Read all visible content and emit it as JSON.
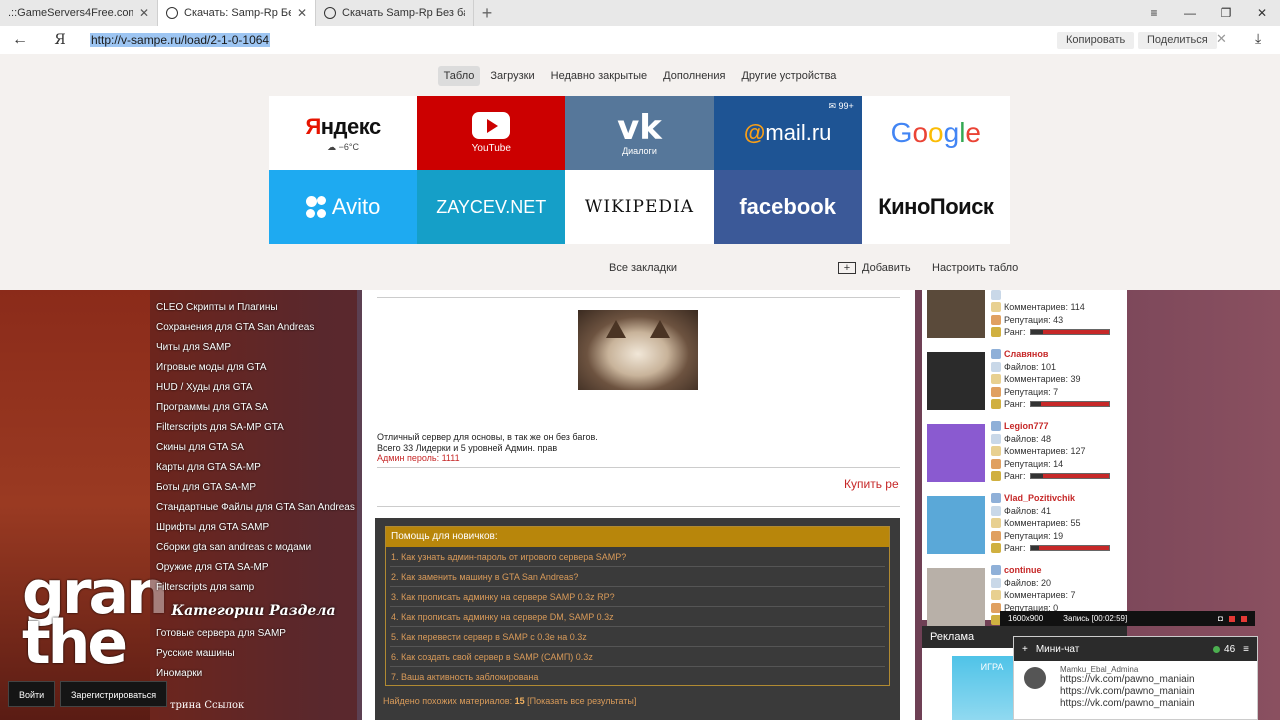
{
  "browser": {
    "tabs": [
      {
        "label": ".::GameServers4Free.com::.",
        "active": false
      },
      {
        "label": "Скачать: Samp-Rp Без б",
        "active": true
      },
      {
        "label": "Скачать Samp-Rp Без багов",
        "active": false
      }
    ],
    "url": "http://v-sampe.ru/load/2-1-0-1064",
    "ya": "Я",
    "copy": "Копировать",
    "share": "Поделиться"
  },
  "tablo": {
    "nav": [
      "Табло",
      "Загрузки",
      "Недавно закрытые",
      "Дополнения",
      "Другие устройства"
    ],
    "tiles": {
      "yandex_logo_a": "Я",
      "yandex_logo_b": "ндекс",
      "yandex_weather": "☁ −6°C",
      "youtube_caption": "YouTube",
      "vk_caption": "Диалоги",
      "mail_badge": "✉ 99+",
      "mail_logo_b": "mail.ru",
      "avito": "Avito",
      "zaycev": "ZAYCEV.NET",
      "wikipedia": "WIKIPEDIA",
      "facebook": "facebook",
      "kinopoisk": "КиноПоиск"
    },
    "all_bookmarks": "Все закладки",
    "add": "Добавить",
    "configure": "Настроить табло"
  },
  "sidebar": {
    "items_top": [
      "CLEO Скрипты и Плагины",
      "Сохранения для GTA San Andreas",
      "Читы для SAMP",
      "Игровые моды для GTA",
      "HUD / Худы для GTA",
      "Программы для GTA SA",
      "Filterscripts для SA-MP GTA",
      "Скины для GTA SA",
      "Карты для GTA SA-MP",
      "Боты для GTA SA-MP",
      "Стандартные Файлы для GTA San Andreas",
      "Шрифты для GTA SAMP",
      "Сборки gta san andreas с модами",
      "Оружие для GTA SA-MP",
      "Filterscripts для samp"
    ],
    "heading": "Категории Раздела",
    "items_bottom": [
      "Готовые сервера для SAMP",
      "Русские машины",
      "Иномарки"
    ],
    "vitrina": "трина Ссылок"
  },
  "content": {
    "desc_line1": "Отличный сервер для основы, в так же он без багов.",
    "desc_line2": "Всего 33 Лидерки и 5 уровней Админ. прав",
    "desc_line3": "Админ пероль: 1111",
    "buy": "Купить ре",
    "help_title": "Помощь для новичков:",
    "help_questions": [
      "1. Как узнать админ-пароль от игрового сервера SAMP?",
      "2. Как заменить машину в GTA San Andreas?",
      "3. Как прописать админку на сервере SAMP 0.3z RP?",
      "4. Как прописать админку на сервере DM, SAMP 0.3z",
      "5. Как перевести сервер в SAMP с 0.3e на 0.3z",
      "6. Как создать свой сервер в SAMP (САМП) 0.3z",
      "7. Ваша активность заблокирована"
    ],
    "found_prefix": "Найдено похожих материалов:",
    "found_count": "15",
    "found_link": "[Показать все результаты]"
  },
  "users": [
    {
      "name": "",
      "files": "",
      "comments": "Комментариев: 114",
      "rep": "Репутация: 43",
      "rank": "Ранг:",
      "level": 0.15,
      "avatar": "#5a4a3a"
    },
    {
      "name": "Славянов",
      "files": "Файлов: 101",
      "comments": "Комментариев: 39",
      "rep": "Репутация: 7",
      "rank": "Ранг:",
      "level": 0.12,
      "avatar": "#2b2b2b"
    },
    {
      "name": "Legion777",
      "files": "Файлов: 48",
      "comments": "Комментариев: 127",
      "rep": "Репутация: 14",
      "rank": "Ранг:",
      "level": 0.15,
      "avatar": "#8a5ad0"
    },
    {
      "name": "Vlad_Pozitivchik",
      "files": "Файлов: 41",
      "comments": "Комментариев: 55",
      "rep": "Репутация: 19",
      "rank": "Ранг:",
      "level": 0.1,
      "avatar": "#5aa8d8"
    },
    {
      "name": "continue",
      "files": "Файлов: 20",
      "comments": "Комментариев: 7",
      "rep": "Репутация: 0",
      "rank": "Ранг:",
      "level": 0.1,
      "avatar": "#b8b0a8"
    }
  ],
  "ads": {
    "title": "Реклама",
    "banner": "ИГРА"
  },
  "recorder": {
    "res": "1600x900",
    "rec": "Запись [00:02:59]"
  },
  "minichat": {
    "title": "Мини-чат",
    "online": "46",
    "author": "Mamku_Ebal_Admina",
    "links": [
      "https://vk.com/pawno_maniain",
      "https://vk.com/pawno_maniain",
      "https://vk.com/pawno_maniain"
    ]
  },
  "auth": {
    "login": "Войти",
    "register": "Зарегистрироваться"
  },
  "colors": {
    "accent_red": "#c62828",
    "help_gold": "#b8860b"
  }
}
